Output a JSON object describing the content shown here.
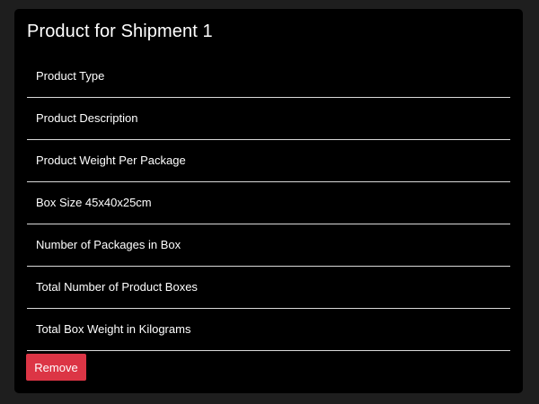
{
  "card": {
    "title": "Product for Shipment 1",
    "fields": [
      {
        "label": "Product Type"
      },
      {
        "label": "Product Description"
      },
      {
        "label": "Product Weight Per Package"
      },
      {
        "label": "Box Size 45x40x25cm"
      },
      {
        "label": "Number of Packages in Box"
      },
      {
        "label": "Total Number of Product Boxes"
      },
      {
        "label": "Total Box Weight in Kilograms"
      }
    ],
    "remove_label": "Remove"
  },
  "colors": {
    "page_background": "#1e1e1e",
    "card_background": "#000000",
    "text": "#ffffff",
    "divider": "#d9d9d9",
    "danger": "#dc3545"
  }
}
